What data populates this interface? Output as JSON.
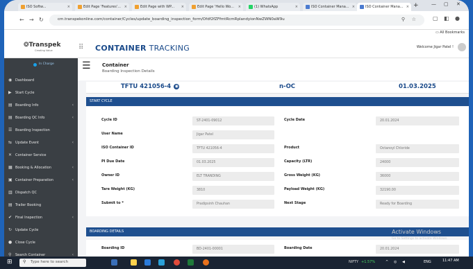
{
  "browser": {
    "tabs": [
      {
        "label": "ISO Softw...",
        "color": "#f0a030"
      },
      {
        "label": "Edit Page 'Features'...",
        "color": "#f0a030"
      },
      {
        "label": "Edit Page with WP...",
        "color": "#f0a030"
      },
      {
        "label": "Edit Page 'Hello Wo...",
        "color": "#f0a030"
      },
      {
        "label": "(1) WhatsApp",
        "color": "#25d366"
      },
      {
        "label": "ISO Container Mana...",
        "color": "#4b7bd0"
      },
      {
        "label": "ISO Container Mana...",
        "color": "#4b7bd0"
      }
    ],
    "url": "cm.transpekonline.com/container/Cycles/update_boarding_inspection_form/Ofdf2fZFfmtRcmRplandyionNwZWN0aW9u",
    "bookmarks": "All Bookmarks"
  },
  "header": {
    "logo": "Transpek",
    "logo_sub": "Creating Value",
    "app_title_bold": "CONTAINER",
    "app_title_light": " TRACKING",
    "welcome": "Welcome Jigar Patel !"
  },
  "sidebar": {
    "user_status": "In Charge",
    "items": [
      {
        "label": "Dashboard",
        "icon": "◉",
        "chev": false
      },
      {
        "label": "Start Cycle",
        "icon": "▶",
        "chev": false
      },
      {
        "label": "Boarding Info",
        "icon": "▤",
        "chev": true
      },
      {
        "label": "Boarding QC Info",
        "icon": "▤",
        "chev": true
      },
      {
        "label": "Boarding Inspection",
        "icon": "☰",
        "chev": false
      },
      {
        "label": "Update Event",
        "icon": "⇆",
        "chev": true
      },
      {
        "label": "Container Service",
        "icon": "✕",
        "chev": false
      },
      {
        "label": "Booking & Allocation",
        "icon": "▦",
        "chev": true
      },
      {
        "label": "Container Preparation",
        "icon": "▣",
        "chev": true
      },
      {
        "label": "Dispatch QC",
        "icon": "▥",
        "chev": false
      },
      {
        "label": "Trailer Booking",
        "icon": "▤",
        "chev": false
      },
      {
        "label": "Final Inspection",
        "icon": "✔",
        "chev": true
      },
      {
        "label": "Update Cycle",
        "icon": "↻",
        "chev": false
      },
      {
        "label": "Close Cycle",
        "icon": "●",
        "chev": false
      },
      {
        "label": "Search Container",
        "icon": "⚲",
        "chev": true
      }
    ]
  },
  "page": {
    "title": "Container",
    "subtitle": "Boarding Inspection Details",
    "container_id": "TFTU 421056-4",
    "status": "n-OC",
    "date": "01.03.2025"
  },
  "sections": {
    "start_cycle": "START CYCLE",
    "boarding_details": "BOARDING DETAILS"
  },
  "fields": {
    "cycle_id": {
      "label": "Cycle ID",
      "value": "ST-2401-09012"
    },
    "cycle_date": {
      "label": "Cycle Date",
      "value": "20.01.2024"
    },
    "user_name": {
      "label": "User Name",
      "value": "Jigar Patel"
    },
    "iso_container_id": {
      "label": "ISO Container ID",
      "value": "TFTU 421056-4"
    },
    "product": {
      "label": "Product",
      "value": "Octanoyl Chloride"
    },
    "pi_due_date": {
      "label": "PI Due Date",
      "value": "01.03.2025"
    },
    "capacity": {
      "label": "Capacity (LTR)",
      "value": "24000"
    },
    "owner_id": {
      "label": "Owner ID",
      "value": "ELT TRANDING"
    },
    "gross_weight": {
      "label": "Gross Weight (KG)",
      "value": "36000"
    },
    "tare_weight": {
      "label": "Tare Weight (KG)",
      "value": "3810"
    },
    "payload_weight": {
      "label": "Payload Weight (KG)",
      "value": "32190.00"
    },
    "submit_to": {
      "label": "Submit to *",
      "value": "Pradipsinh Chauhan"
    },
    "next_stage": {
      "label": "Next Stage",
      "value": "Ready for Boarding"
    },
    "boarding_id": {
      "label": "Boarding ID",
      "value": "BD-2401-00001"
    },
    "boarding_date": {
      "label": "Boarding Date",
      "value": "20.01.2024"
    }
  },
  "watermark": {
    "title": "Activate Windows",
    "sub": "Go to Settings to activate Windows."
  },
  "taskbar": {
    "search_placeholder": "Type here to search",
    "nifty": "NIFTY",
    "nifty_change": "+1.57%",
    "lang": "ENG",
    "time": "11:47 AM"
  }
}
